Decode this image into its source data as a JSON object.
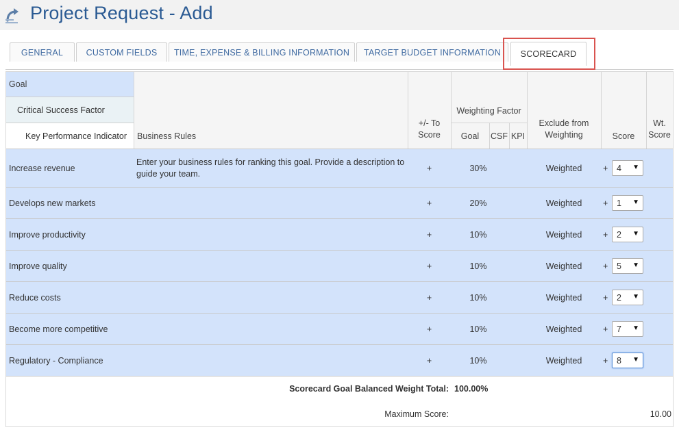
{
  "page": {
    "title": "Project Request - Add",
    "logo_icon": "refresh-arrow-icon"
  },
  "tabs": [
    {
      "label": "GENERAL"
    },
    {
      "label": "CUSTOM FIELDS"
    },
    {
      "label": "TIME, EXPENSE & BILLING INFORMATION"
    },
    {
      "label": "TARGET BUDGET INFORMATION"
    },
    {
      "label": "SCORECARD",
      "active": true
    }
  ],
  "headers": {
    "goal": "Goal",
    "csf": "Critical Success Factor",
    "kpi": "Key Performance Indicator",
    "business_rules": "Business Rules",
    "plus_minus_line1": "+/- To",
    "plus_minus_line2": "Score",
    "weighting_factor": "Weighting Factor",
    "wf_goal": "Goal",
    "wf_csf": "CSF",
    "wf_kpi": "KPI",
    "exclude_line1": "Exclude from",
    "exclude_line2": "Weighting",
    "score": "Score",
    "wt_line1": "Wt.",
    "wt_line2": "Score"
  },
  "rows": [
    {
      "goal": "Increase revenue",
      "business_rules": "Enter your business rules for ranking this goal. Provide a description to guide your team.",
      "sign": "+",
      "goal_weight": "30%",
      "exclude": "Weighted",
      "score_sign": "+",
      "score": "4"
    },
    {
      "goal": "Develops new markets",
      "business_rules": "",
      "sign": "+",
      "goal_weight": "20%",
      "exclude": "Weighted",
      "score_sign": "+",
      "score": "1"
    },
    {
      "goal": "Improve productivity",
      "business_rules": "",
      "sign": "+",
      "goal_weight": "10%",
      "exclude": "Weighted",
      "score_sign": "+",
      "score": "2"
    },
    {
      "goal": "Improve quality",
      "business_rules": "",
      "sign": "+",
      "goal_weight": "10%",
      "exclude": "Weighted",
      "score_sign": "+",
      "score": "5"
    },
    {
      "goal": "Reduce costs",
      "business_rules": "",
      "sign": "+",
      "goal_weight": "10%",
      "exclude": "Weighted",
      "score_sign": "+",
      "score": "2"
    },
    {
      "goal": "Become more competitive",
      "business_rules": "",
      "sign": "+",
      "goal_weight": "10%",
      "exclude": "Weighted",
      "score_sign": "+",
      "score": "7"
    },
    {
      "goal": "Regulatory - Compliance",
      "business_rules": "",
      "sign": "+",
      "goal_weight": "10%",
      "exclude": "Weighted",
      "score_sign": "+",
      "score": "8"
    }
  ],
  "footer": {
    "total_label": "Scorecard Goal Balanced Weight Total:",
    "total_value": "100.00%",
    "max_label": "Maximum Score:",
    "max_value": "10.00"
  },
  "colors": {
    "title": "#2a5a93",
    "row_bg": "#d3e3fb",
    "highlight": "#d9534f"
  }
}
